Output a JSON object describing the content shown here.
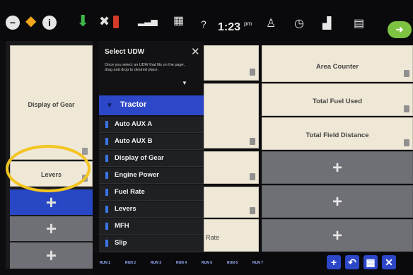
{
  "top_bar": {
    "clock": "1:23",
    "clock_suffix": "pm",
    "info_glyph": "i",
    "icons": [
      "minus-circle-icon",
      "warning-diamond-icon",
      "info-icon",
      "download-arrow-icon",
      "wrench-warning-icon",
      "signal-icon",
      "grid-icon",
      "help-icon",
      "user-icon",
      "gauge-icon",
      "bar-chart-icon",
      "field-icon",
      "go-button-icon"
    ]
  },
  "left_column": {
    "display_of_gear": "Display of Gear",
    "levers": "Levers"
  },
  "udw_panel": {
    "title": "Select UDW",
    "close": "✕",
    "description": "Once you select an UDW that fits on the page, drag and drop to desired place.",
    "category": "Tractor",
    "items": [
      "Auto AUX A",
      "Auto AUX B",
      "Display of Gear",
      "Engine Power",
      "Fuel Rate",
      "Levers",
      "MFH",
      "Slip"
    ]
  },
  "main_grid": {
    "area_counter": "Area Counter",
    "total_fuel_used": "Total Fuel Used",
    "total_field_distance": "Total Field Distance",
    "rate_fragment": "Rate"
  },
  "bottom_bar": {
    "runs": [
      "RUN 1",
      "RUN 2",
      "RUN 3",
      "RUN 4",
      "RUN 5",
      "RUN 6",
      "RUN 7"
    ],
    "buttons": [
      "+",
      "↶",
      "▦",
      "✕"
    ]
  },
  "colors": {
    "highlight_oval": "#f4c520",
    "selection_blue": "#2d47c9",
    "tile_cream": "#efe8d6",
    "empty_tile": "#6f7075"
  }
}
